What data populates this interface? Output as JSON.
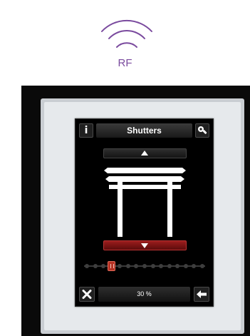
{
  "badge": {
    "label": "RF",
    "icon": "wireless-signal-icon",
    "color": "#7a4a9e"
  },
  "device": {
    "screen": {
      "title": "Shutters",
      "info_icon_text": "i",
      "settings_icon": "settings-gear-icon",
      "up_icon": "triangle-up-icon",
      "down_icon": "triangle-down-icon",
      "close_icon": "close-x-icon",
      "back_icon": "arrow-left-icon",
      "position_label": "30 %",
      "slider": {
        "steps": 15,
        "selected_step": 3,
        "accent": "#b53224"
      }
    }
  }
}
